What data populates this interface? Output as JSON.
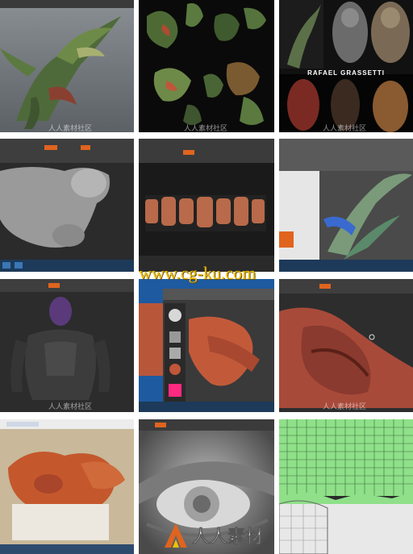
{
  "tiles": [
    {
      "name": "tile-creature-render",
      "desc": ""
    },
    {
      "name": "tile-texture-maps",
      "desc": ""
    },
    {
      "name": "tile-artist-gallery",
      "caption": "RAFAEL GRASSETTI"
    },
    {
      "name": "tile-zbrush-sculpt-gray"
    },
    {
      "name": "tile-zbrush-uv-pieces"
    },
    {
      "name": "tile-maya-plant-rig"
    },
    {
      "name": "tile-zbrush-armored-hero"
    },
    {
      "name": "tile-zbrush-orange-sculpt"
    },
    {
      "name": "tile-zbrush-closeup-red"
    },
    {
      "name": "tile-photo-creature"
    },
    {
      "name": "tile-eye-sculpt"
    },
    {
      "name": "tile-uv-wireframe"
    }
  ],
  "watermark": {
    "url": "www.cg-ku.com",
    "small_text": "人人素材社区"
  },
  "logo": {
    "text": "人人素材"
  },
  "colors": {
    "zbrush_orange": "#e0641e",
    "watermark_yellow": "#f0c000",
    "uv_green": "#8fe089"
  }
}
